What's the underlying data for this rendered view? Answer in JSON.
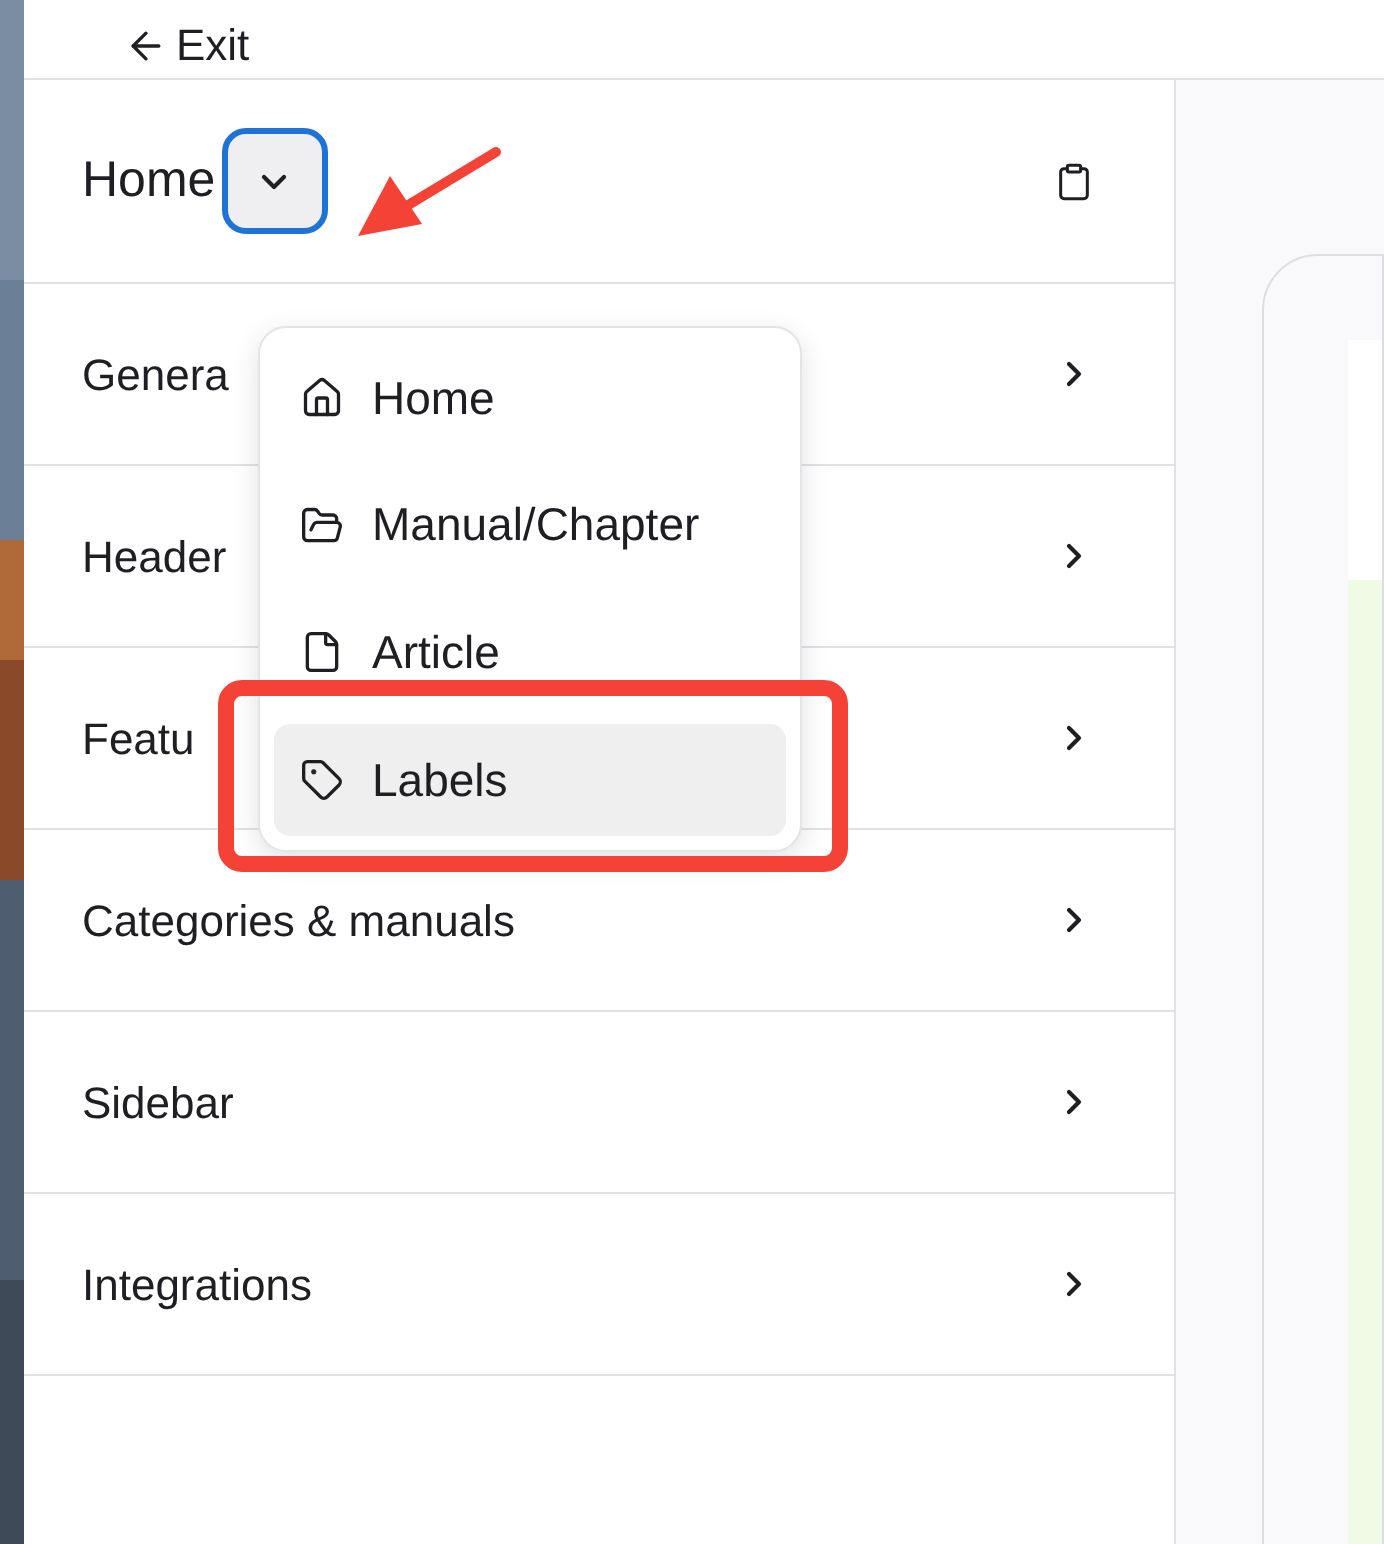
{
  "topbar": {
    "exit_label": "Exit"
  },
  "panel": {
    "title": "Home",
    "dropdown_open": true
  },
  "sections": [
    {
      "label": "Genera"
    },
    {
      "label": "Header"
    },
    {
      "label": "Featu"
    },
    {
      "label": "Categories & manuals"
    },
    {
      "label": "Sidebar"
    },
    {
      "label": "Integrations"
    }
  ],
  "menu": [
    {
      "label": "Home",
      "kind": "home",
      "selected": false
    },
    {
      "label": "Manual/Chapter",
      "kind": "folder",
      "selected": false
    },
    {
      "label": "Article",
      "kind": "file",
      "selected": false
    },
    {
      "label": "Labels",
      "kind": "tag",
      "selected": true
    }
  ],
  "annotations": {
    "arrow": true,
    "highlight_box": true
  }
}
